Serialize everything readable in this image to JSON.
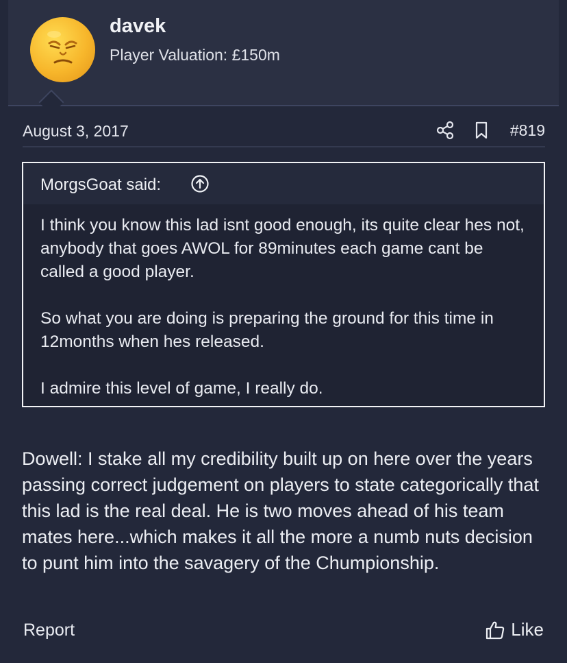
{
  "user": {
    "name": "davek",
    "title": "Player Valuation: £150m",
    "avatar_icon": "orange-emoji-avatar"
  },
  "post": {
    "date": "August 3, 2017",
    "number": "#819",
    "share_icon": "share-icon",
    "bookmark_icon": "bookmark-icon"
  },
  "quote": {
    "author": "MorgsGoat said:",
    "jump_icon": "arrow-up-circle-icon",
    "paragraphs": [
      "I think you know this lad isnt good enough, its quite clear hes not, anybody that goes AWOL for 89minutes each game cant be called a good player.",
      "So what you are doing is preparing the ground for this time in 12months when hes released.",
      "I admire this level of game, I really do."
    ]
  },
  "message": {
    "text": "Dowell: I stake all my credibility built up on here over the years passing correct judgement on players to state categorically that this lad is the real deal. He is two moves ahead of his team mates here...which makes it all the more a numb nuts decision to punt him into the savagery of the Chumpionship."
  },
  "footer": {
    "report_label": "Report",
    "like_label": "Like",
    "like_icon": "thumbs-up-icon"
  },
  "colors": {
    "background": "#23283a",
    "header_background": "#2b3043",
    "quote_border": "#f2f3f6",
    "text": "#e9ebf1",
    "avatar": "#f7b62b"
  }
}
